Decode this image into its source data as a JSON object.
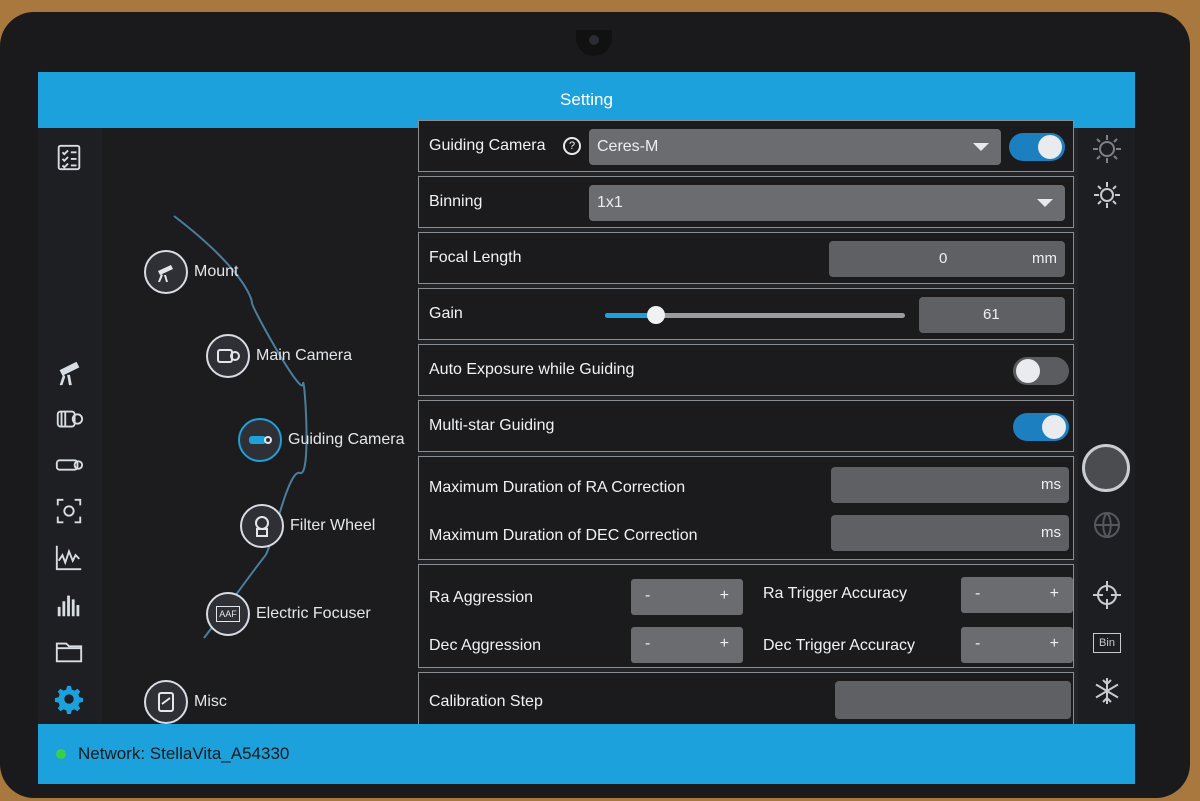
{
  "window": {
    "title": "Setting"
  },
  "left_nav": [
    {
      "icon": "checklist-icon"
    },
    {
      "icon": "mount-icon"
    },
    {
      "icon": "main-camera-icon"
    },
    {
      "icon": "guiding-camera-icon"
    },
    {
      "icon": "focus-frame-icon"
    },
    {
      "icon": "waveform-icon"
    },
    {
      "icon": "histogram-icon"
    },
    {
      "icon": "folder-icon"
    },
    {
      "icon": "settings-gear-icon",
      "active_color": "#1da1dc"
    }
  ],
  "tree": {
    "nodes": [
      {
        "label": "Mount",
        "icon": "mount-icon"
      },
      {
        "label": "Main Camera",
        "icon": "main-camera-icon"
      },
      {
        "label": "Guiding Camera",
        "icon": "guiding-camera-icon",
        "active": true
      },
      {
        "label": "Filter Wheel",
        "icon": "filter-wheel-icon"
      },
      {
        "label": "Electric Focuser",
        "icon": "focuser-icon",
        "icon_text": "AAF"
      },
      {
        "label": "Misc",
        "icon": "misc-icon"
      }
    ]
  },
  "settings": {
    "guiding_camera": {
      "label": "Guiding Camera",
      "help_icon": "help-icon",
      "value": "Ceres-M",
      "enabled": true
    },
    "binning": {
      "label": "Binning",
      "value": "1x1"
    },
    "focal_length": {
      "label": "Focal Length",
      "value": "0",
      "unit": "mm"
    },
    "gain": {
      "label": "Gain",
      "value": "61",
      "slider_fraction": 0.17
    },
    "auto_exposure": {
      "label": "Auto Exposure while Guiding",
      "enabled": false
    },
    "multi_star": {
      "label": "Multi-star Guiding",
      "enabled": true
    },
    "max_ra": {
      "label": "Maximum Duration of RA Correction",
      "unit": "ms"
    },
    "max_dec": {
      "label": "Maximum Duration of DEC Correction",
      "unit": "ms"
    },
    "ra_aggression": {
      "label": "Ra Aggression",
      "minus": "-",
      "plus": "+"
    },
    "ra_trigger": {
      "label": "Ra Trigger Accuracy",
      "minus": "-",
      "plus": "+"
    },
    "dec_aggression": {
      "label": "Dec Aggression",
      "minus": "-",
      "plus": "+"
    },
    "dec_trigger": {
      "label": "Dec Trigger Accuracy",
      "minus": "-",
      "plus": "+"
    },
    "calibration_step": {
      "label": "Calibration Step",
      "value": ""
    }
  },
  "right_toolbar": [
    {
      "icon": "sun-dial-icon"
    },
    {
      "icon": "brightness-icon"
    },
    {
      "icon": "shutter-button-icon"
    },
    {
      "icon": "globe-icon"
    },
    {
      "icon": "crosshair-icon"
    },
    {
      "icon": "bin-icon",
      "text": "Bin"
    },
    {
      "icon": "snowflake-icon"
    }
  ],
  "status": {
    "network_label": "Network: StellaVita_A54330",
    "dot_color": "#38d04a"
  },
  "colors": {
    "accent": "#1da1dc",
    "toggle_on": "#1c7fc0"
  }
}
